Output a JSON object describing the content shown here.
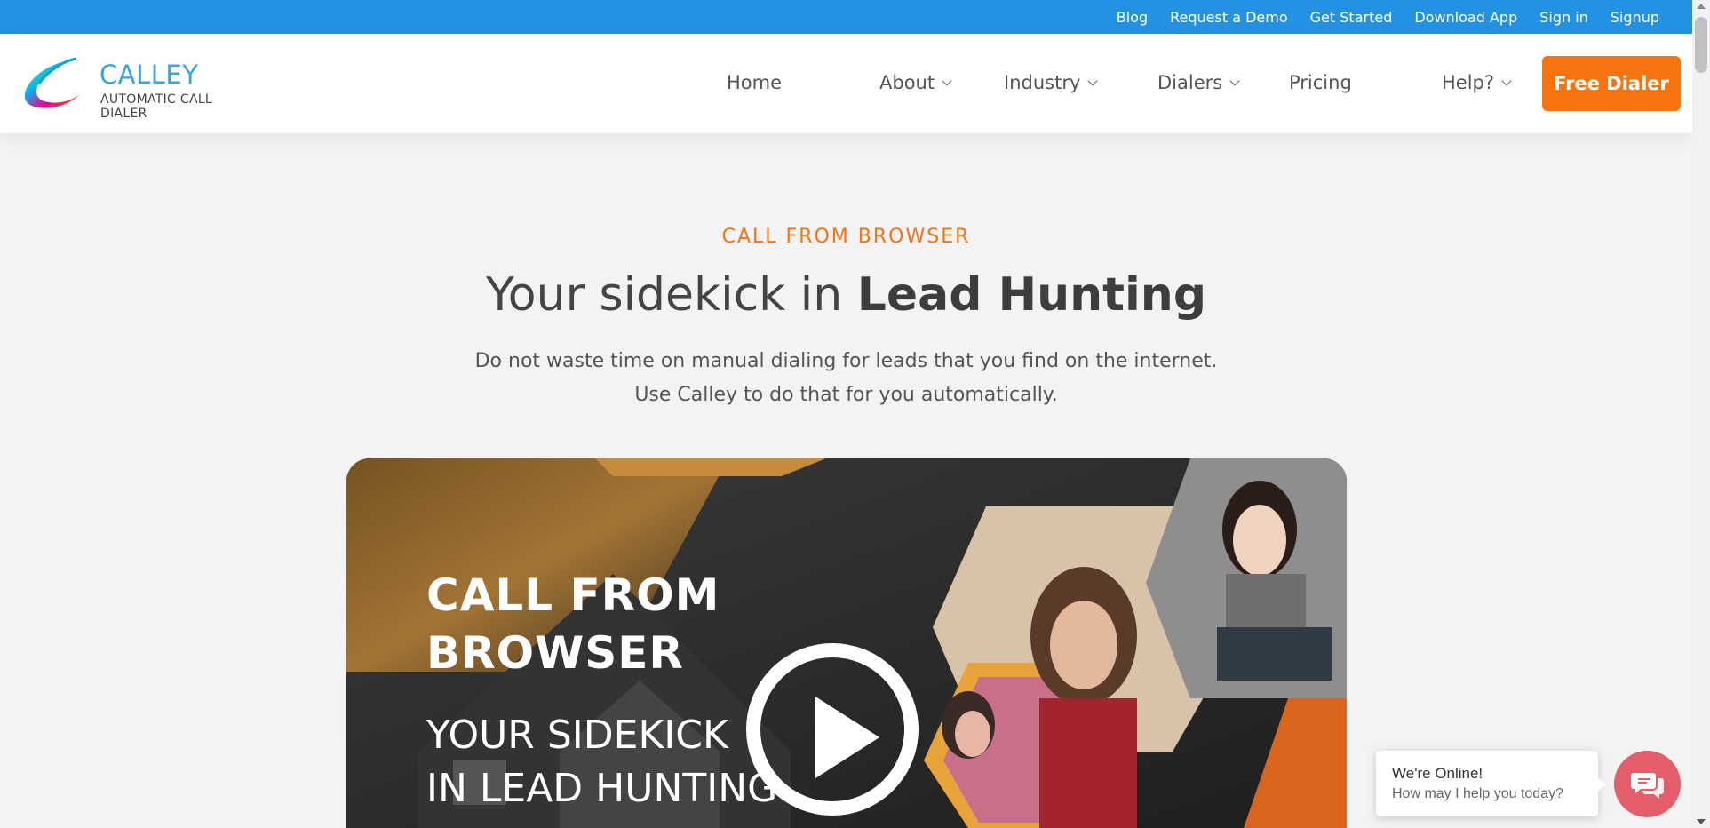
{
  "topbar": {
    "links": [
      "Blog",
      "Request a Demo",
      "Get Started",
      "Download App",
      "Sign in",
      "Signup"
    ]
  },
  "logo": {
    "name": "CALLEY",
    "tagline": "AUTOMATIC CALL DIALER"
  },
  "nav": {
    "home": "Home",
    "about": "About",
    "industry": "Industry",
    "dialers": "Dialers",
    "pricing": "Pricing",
    "help": "Help?",
    "cta": "Free Dialer"
  },
  "hero": {
    "eyebrow": "CALL FROM BROWSER",
    "headline_plain": "Your sidekick in ",
    "headline_bold": "Lead Hunting",
    "sub_line1": "Do not waste time on manual dialing for leads that you find on the internet.",
    "sub_line2": "Use Calley to do that for you automatically."
  },
  "video": {
    "title_line1": "CALL FROM",
    "title_line2": "BROWSER",
    "subtitle_line1": "YOUR SIDEKICK",
    "subtitle_line2": "IN LEAD HUNTING"
  },
  "chat": {
    "title": "We're Online!",
    "subtitle": "How may I help you today?"
  },
  "colors": {
    "topbar": "#2492e3",
    "accent": "#f7730e",
    "chat": "#e35d6a"
  }
}
